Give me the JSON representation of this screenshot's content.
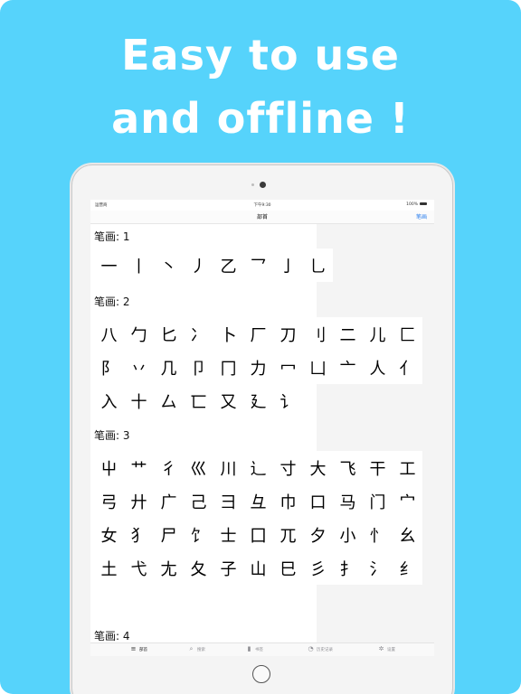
{
  "headline": {
    "line1": "Easy to use",
    "line2": "and offline !"
  },
  "status_bar": {
    "carrier": "运营商",
    "time": "下午9:30",
    "battery": "100%"
  },
  "nav": {
    "title": "部首",
    "right_button": "笔画"
  },
  "sections": [
    {
      "label": "笔画: 1",
      "rows": [
        [
          "一",
          "丨",
          "丶",
          "丿",
          "乙",
          "乛",
          "亅",
          "乚"
        ]
      ]
    },
    {
      "label": "笔画: 2",
      "rows": [
        [
          "八",
          "勹",
          "匕",
          "冫",
          "卜",
          "厂",
          "刀",
          "刂",
          "二",
          "儿",
          "匚"
        ],
        [
          "阝",
          "丷",
          "几",
          "卩",
          "冂",
          "力",
          "冖",
          "凵",
          "亠",
          "人",
          "亻"
        ],
        [
          "入",
          "十",
          "厶",
          "匸",
          "又",
          "廴",
          "讠"
        ]
      ]
    },
    {
      "label": "笔画: 3",
      "rows": [
        [
          "屮",
          "艹",
          "彳",
          "巛",
          "川",
          "辶",
          "寸",
          "大",
          "飞",
          "干",
          "工"
        ],
        [
          "弓",
          "廾",
          "广",
          "己",
          "彐",
          "彑",
          "巾",
          "口",
          "马",
          "门",
          "宀"
        ],
        [
          "女",
          "犭",
          "尸",
          "饣",
          "士",
          "囗",
          "兀",
          "夕",
          "小",
          "忄",
          "幺"
        ],
        [
          "土",
          "弋",
          "尢",
          "夂",
          "子",
          "山",
          "巳",
          "彡",
          "扌",
          "氵",
          "纟"
        ]
      ]
    },
    {
      "label": "笔画: 4",
      "rows": []
    }
  ],
  "tabs": [
    {
      "label": "部首",
      "icon": "filter-icon",
      "glyph": "≡",
      "active": true
    },
    {
      "label": "搜索",
      "icon": "search-icon",
      "glyph": "⌕",
      "active": false
    },
    {
      "label": "书签",
      "icon": "book-icon",
      "glyph": "▮",
      "active": false
    },
    {
      "label": "历史记录",
      "icon": "clock-icon",
      "glyph": "◔",
      "active": false
    },
    {
      "label": "设置",
      "icon": "gear-icon",
      "glyph": "✲",
      "active": false
    }
  ],
  "colors": {
    "background": "#56d3fb",
    "accent": "#2f80ed"
  }
}
